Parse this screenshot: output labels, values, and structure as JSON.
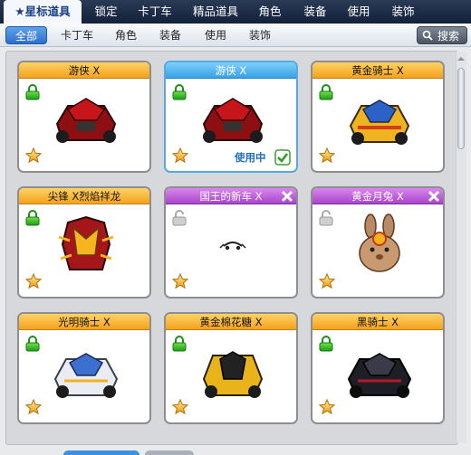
{
  "top_tabs": [
    {
      "label": "★星标道具",
      "active": true
    },
    {
      "label": "锁定"
    },
    {
      "label": "卡丁车"
    },
    {
      "label": "精品道具"
    },
    {
      "label": "角色"
    },
    {
      "label": "装备"
    },
    {
      "label": "使用"
    },
    {
      "label": "装饰"
    }
  ],
  "sub_tabs": [
    {
      "label": "全部",
      "active": true
    },
    {
      "label": "卡丁车"
    },
    {
      "label": "角色"
    },
    {
      "label": "装备"
    },
    {
      "label": "使用"
    },
    {
      "label": "装饰"
    }
  ],
  "search": {
    "label": "搜索",
    "icon": "search-icon"
  },
  "items": [
    {
      "name": "游侠 X",
      "header": "orange",
      "locked": true,
      "art": "red-kart"
    },
    {
      "name": "游侠 X",
      "header": "blue",
      "locked": true,
      "art": "red-kart",
      "in_use": true,
      "in_use_label": "使用中"
    },
    {
      "name": "黄金骑士 X",
      "header": "orange",
      "locked": true,
      "art": "gold-kart"
    },
    {
      "name": "尖锋 X烈焰祥龙",
      "header": "orange",
      "locked": true,
      "art": "dragon-kart"
    },
    {
      "name": "国王的新车 X",
      "header": "purple",
      "locked": false,
      "art": "invisible-kart",
      "removable": true
    },
    {
      "name": "黄金月兔 X",
      "header": "purple",
      "locked": false,
      "art": "rabbit",
      "removable": true
    },
    {
      "name": "光明骑士 X",
      "header": "orange",
      "locked": true,
      "art": "white-kart"
    },
    {
      "name": "黄金棉花糖 X",
      "header": "orange",
      "locked": true,
      "art": "gold-black-kart"
    },
    {
      "name": "黑骑士 X",
      "header": "orange",
      "locked": true,
      "art": "black-kart"
    }
  ],
  "colors": {
    "accent": "#2d6fcb",
    "header_orange": "#f4a21c",
    "header_purple": "#a945cb",
    "header_blue": "#38a2e5"
  }
}
